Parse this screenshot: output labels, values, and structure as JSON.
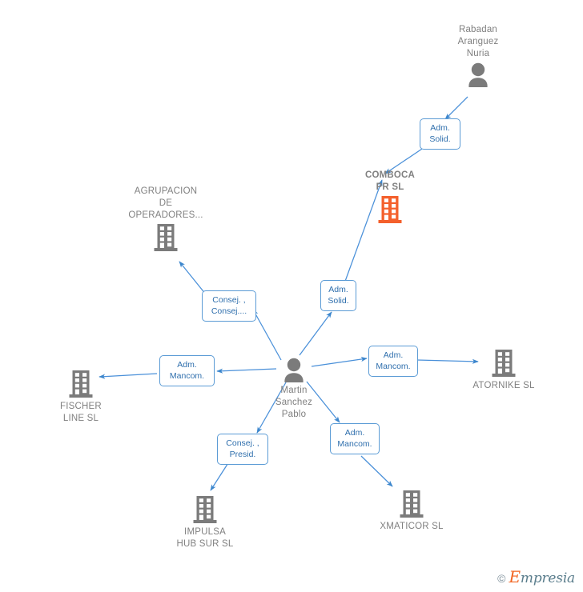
{
  "diagram": {
    "type": "corporate-relationship-network",
    "background_color": "#ffffff",
    "focal_color": "#f4602c",
    "node_color": "#7b7b7b",
    "edge_color": "#4a90d9",
    "label_text_color": "#2f6fad",
    "label_border_color": "#5b9bd5"
  },
  "nodes": {
    "rabadan": {
      "label": "Rabadan\nAranguez\nNuria",
      "icon": "person-icon",
      "kind": "person"
    },
    "comboca": {
      "label": "COMBOCA\nPR  SL",
      "icon": "building-icon",
      "kind": "company-focal"
    },
    "agrupacion": {
      "label": "AGRUPACION\nDE\nOPERADORES...",
      "icon": "building-icon",
      "kind": "company"
    },
    "martin": {
      "label": "Martin\nSanchez\nPablo",
      "icon": "person-icon",
      "kind": "person"
    },
    "fischer": {
      "label": "FISCHER\nLINE  SL",
      "icon": "building-icon",
      "kind": "company"
    },
    "atornike": {
      "label": "ATORNIKE  SL",
      "icon": "building-icon",
      "kind": "company"
    },
    "impulsa": {
      "label": "IMPULSA\nHUB SUR  SL",
      "icon": "building-icon",
      "kind": "company"
    },
    "xmaticor": {
      "label": "XMATICOR SL",
      "icon": "building-icon",
      "kind": "company"
    }
  },
  "edges": {
    "rabadan_comboca": {
      "label": "Adm.\nSolid.",
      "from": "rabadan",
      "to": "comboca"
    },
    "martin_comboca": {
      "label": "Adm.\nSolid.",
      "from": "martin",
      "to": "comboca"
    },
    "martin_agrupacion": {
      "label": "Consej. ,\nConsej....",
      "from": "martin",
      "to": "agrupacion"
    },
    "martin_fischer": {
      "label": "Adm.\nMancom.",
      "from": "martin",
      "to": "fischer"
    },
    "martin_atornike": {
      "label": "Adm.\nMancom.",
      "from": "martin",
      "to": "atornike"
    },
    "martin_impulsa": {
      "label": "Consej. ,\nPresid.",
      "from": "martin",
      "to": "impulsa"
    },
    "martin_xmaticor": {
      "label": "Adm.\nMancom.",
      "from": "martin",
      "to": "xmaticor"
    }
  },
  "watermark": {
    "copyright": "©",
    "brand_initial": "E",
    "brand_rest": "mpresia"
  }
}
